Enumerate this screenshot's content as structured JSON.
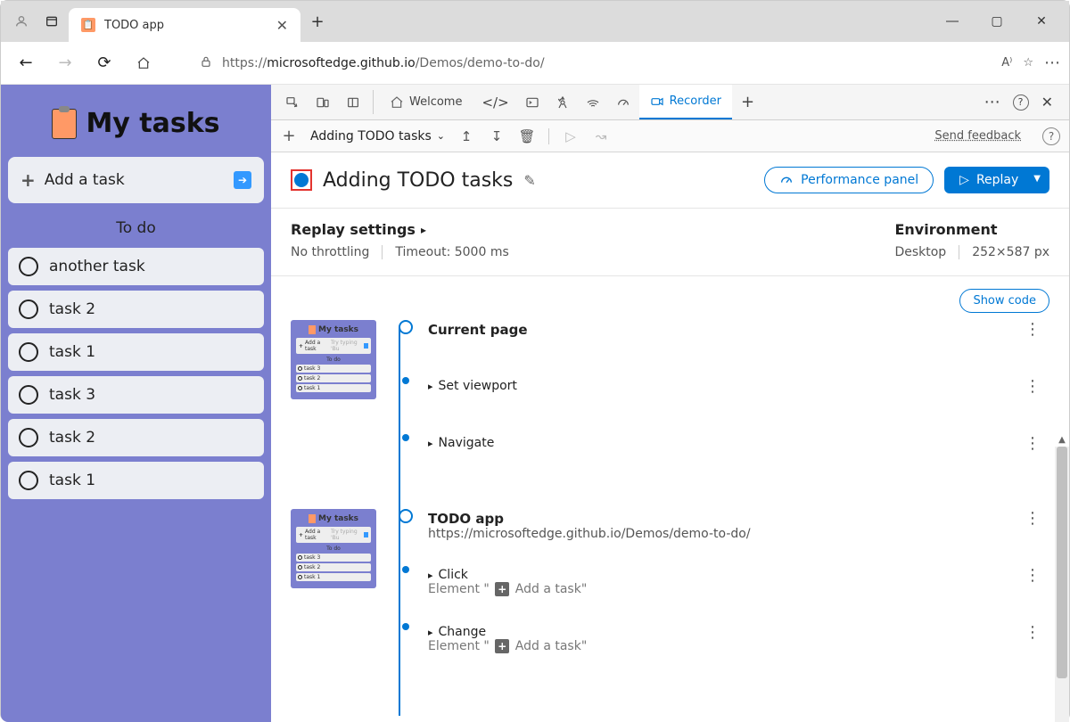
{
  "browser": {
    "tab_title": "TODO app",
    "url_prefix": "https://",
    "url_host": "microsoftedge.github.io",
    "url_path": "/Demos/demo-to-do/"
  },
  "todo": {
    "heading": "My tasks",
    "input_placeholder": "Add a task",
    "section": "To do",
    "tasks": [
      "another task",
      "task 2",
      "task 1",
      "task 3",
      "task 2",
      "task 1"
    ],
    "thumb_tasks_a": [
      "task 3",
      "task 2",
      "task 1"
    ],
    "thumb_tasks_b": [
      "task 3",
      "task 2",
      "task 1"
    ],
    "thumb_input_hint": "Try typing 'Bu"
  },
  "devtools": {
    "welcome_tab": "Welcome",
    "recorder_tab": "Recorder",
    "toolbar": {
      "recording_name": "Adding TODO tasks",
      "send_feedback": "Send feedback"
    },
    "header": {
      "title": "Adding TODO tasks",
      "perf_panel": "Performance panel",
      "replay": "Replay"
    },
    "settings": {
      "replay_title": "Replay settings",
      "no_throttling": "No throttling",
      "timeout": "Timeout: 5000 ms",
      "env_title": "Environment",
      "env_device": "Desktop",
      "env_size": "252×587 px"
    },
    "show_code": "Show code",
    "steps": {
      "block1": {
        "title": "Current page",
        "a1": "Set viewport",
        "a2": "Navigate"
      },
      "block2": {
        "title": "TODO app",
        "sub": "https://microsoftedge.github.io/Demos/demo-to-do/",
        "a1": "Click",
        "a1_el_prefix": "Element \" ",
        "a1_el_text": "Add a task\"",
        "a2": "Change",
        "a2_el_prefix": "Element \" ",
        "a2_el_text": "Add a task\""
      }
    }
  }
}
